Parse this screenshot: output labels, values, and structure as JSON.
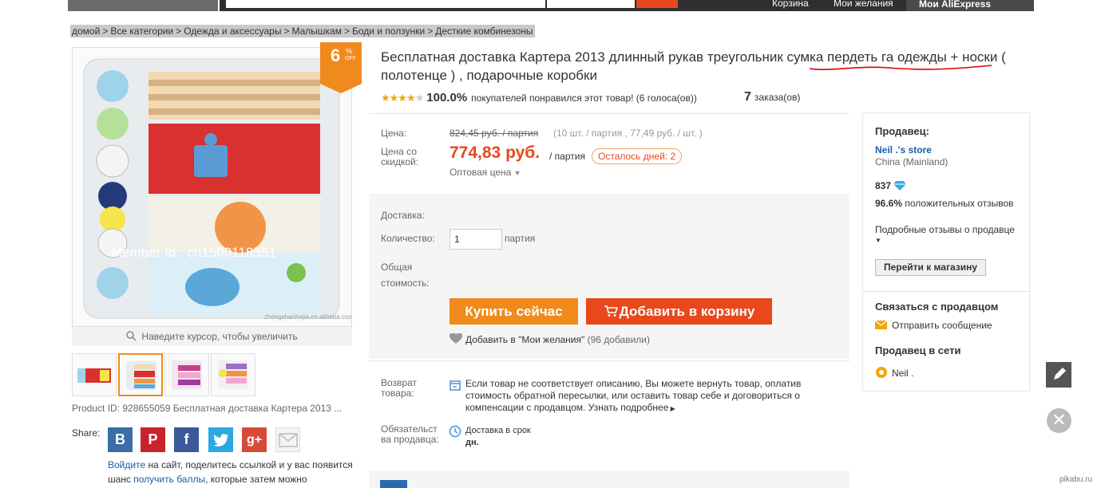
{
  "topnav": {
    "cart": "Корзина",
    "wishlist": "Мои желания",
    "my_aliexpress": "Мои AliExpress"
  },
  "breadcrumb": [
    "домой",
    "Все категории",
    "Одежда и аксессуары",
    "Малышкам",
    "Боди и ползунки",
    "Десткие комбинезоны"
  ],
  "breadcrumb_sep": ">",
  "badge": {
    "value": "6",
    "pct": "%",
    "off": "OFF"
  },
  "main_image": {
    "watermark": "Member Id : cn1500118551",
    "footer_caption": "zhongshanhejia.cn.alibaba.com"
  },
  "zoom_hint": "Наведите курсор, чтобы увеличить",
  "product_id": "Product ID: 928655059 Бесплатная доставка Картера 2013 ...",
  "share": {
    "label": "Share:",
    "note_pre": "на сайт, поделитесь ссылкой и у вас появится шанс ",
    "login": "Войдите",
    "points": "получить баллы",
    "note_post": ", которые затем можно"
  },
  "title": "Бесплатная доставка Картера 2013 длинный рукав треугольник сумка пердеть га одежды + носки ( полотенце ) , подарочные коробки",
  "rating": {
    "stars": 4,
    "percent": "100.0%",
    "text": "покупателей понравился этот товар! (6 голоса(ов))",
    "orders_count": "7",
    "orders_label": "заказа(ов)"
  },
  "price": {
    "label_price": "Цена:",
    "old_price": "824,45 руб. / партия",
    "unit_note": "(10 шт. / партия , 77,49 руб. / шт. )",
    "label_discount": "Цена со скидкой:",
    "new_price": "774,83 руб.",
    "per": "/ партия",
    "days_left": "Осталось дней: 2",
    "wholesale": "Оптовая цена"
  },
  "order": {
    "label_shipping": "Доставка:",
    "label_quantity": "Количество:",
    "quantity_value": "1",
    "quantity_unit": "партия",
    "label_total": "Общая стоимость:",
    "buy_now": "Купить сейчас",
    "add_to_cart": "Добавить в корзину",
    "wishlist_text": "Добавить в \"Мои желания\"",
    "wishlist_count": "(96 добавили)"
  },
  "returns": {
    "label": "Возврат товара:",
    "text": "Если товар не соответствует описанию, Вы можете вернуть товар, оплатив стоимость обратной пересылки, или оставить товар себе и договориться о компенсации с продавцом.",
    "more": "Узнать подробнее"
  },
  "obligations": {
    "label": "Обязательст ва продавца:",
    "text1": "Доставка в срок",
    "text2": "дн."
  },
  "seller": {
    "heading": "Продавец:",
    "store": "Neil .'s store",
    "country": "China (Mainland)",
    "score": "837",
    "positive_pct": "96.6%",
    "positive_text": "положительных отзывов",
    "details": "Подробные отзывы о продавце",
    "goto_store": "Перейти к магазину",
    "contact_heading": "Связаться с продавцом",
    "send_message": "Отправить сообщение",
    "online_heading": "Продавец в сети",
    "online_name": "Neil ."
  },
  "colors": {
    "accent": "#e8481c",
    "orange": "#f08a1c",
    "link": "#1a5da8",
    "star": "#f3a600"
  },
  "site_watermark": "pikabu.ru"
}
